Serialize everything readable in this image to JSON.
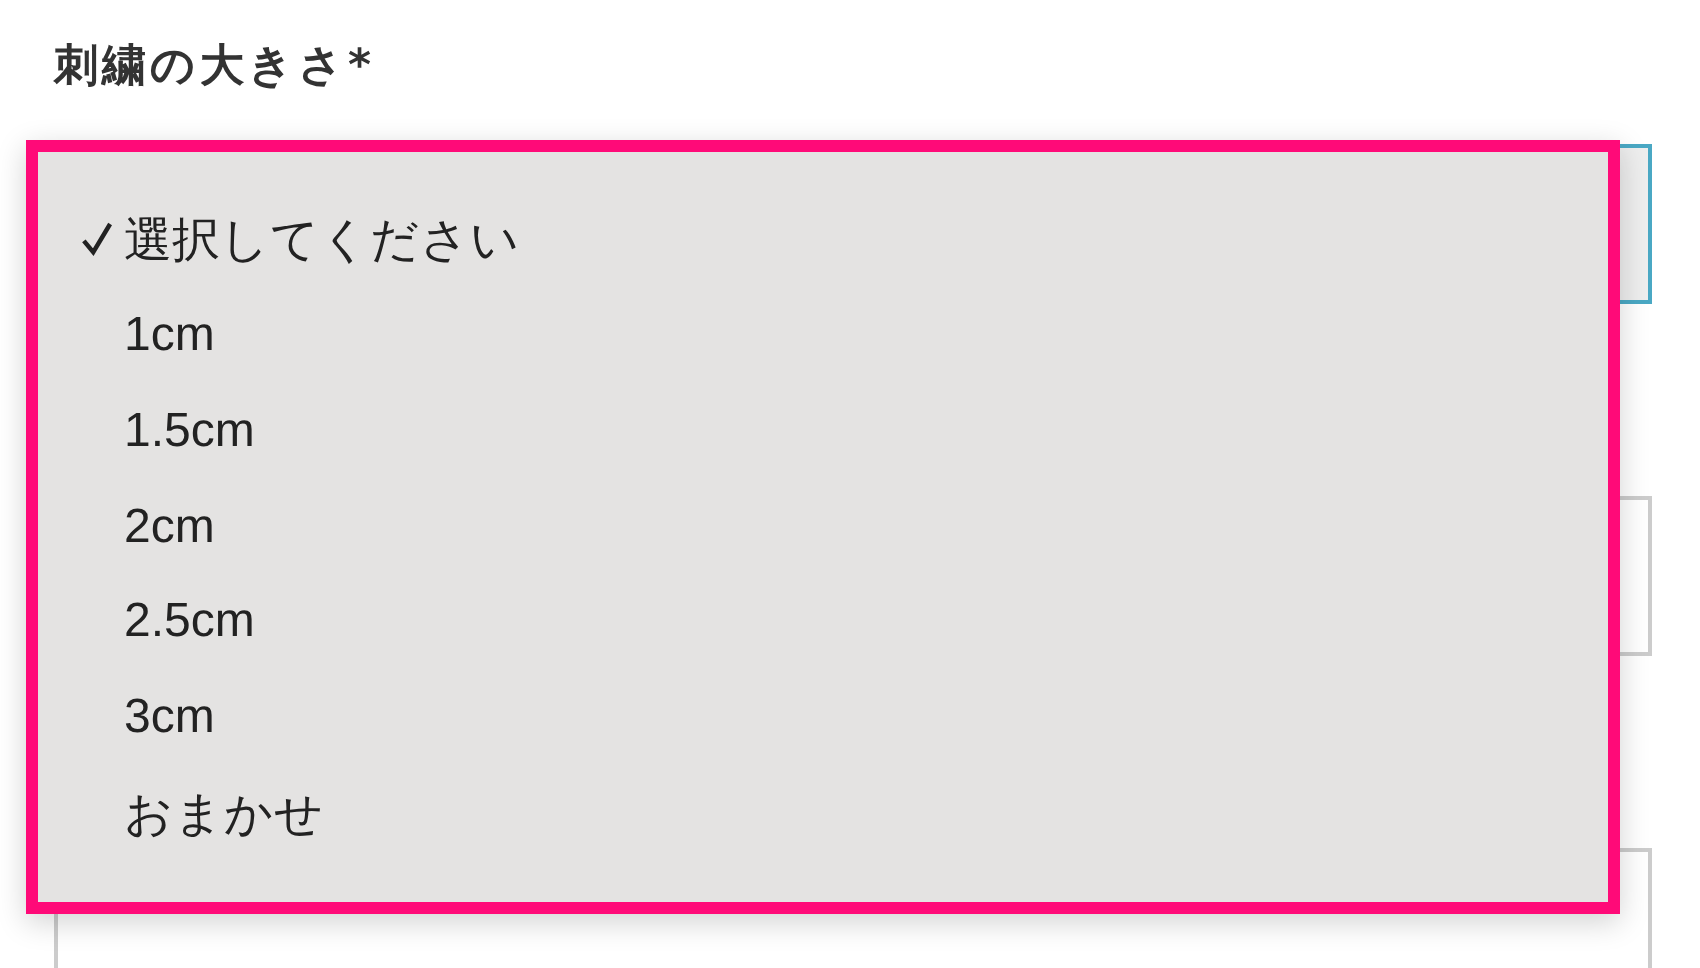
{
  "label": "刺繍の大きさ*",
  "dropdown": {
    "options": [
      {
        "label": "選択してください",
        "selected": true
      },
      {
        "label": "1cm",
        "selected": false
      },
      {
        "label": "1.5cm",
        "selected": false
      },
      {
        "label": "2cm",
        "selected": false
      },
      {
        "label": "2.5cm",
        "selected": false
      },
      {
        "label": "3cm",
        "selected": false
      },
      {
        "label": "おまかせ",
        "selected": false
      }
    ]
  }
}
